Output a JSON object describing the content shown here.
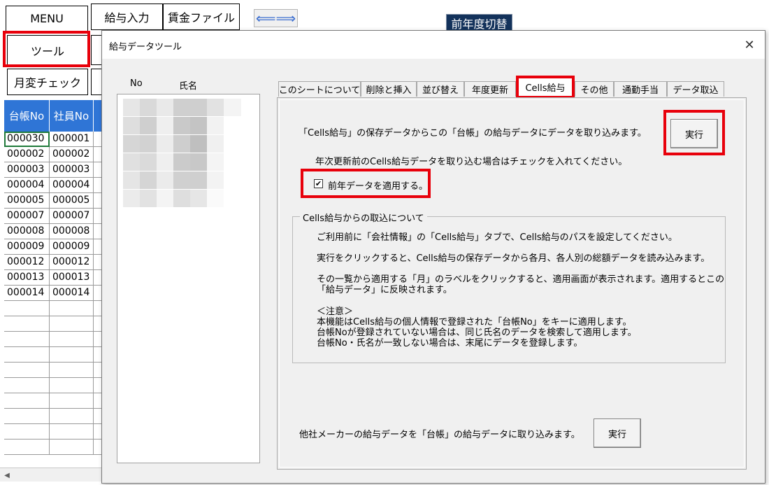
{
  "sheet": {
    "menu_label": "MENU",
    "payroll_input_label": "給与入力",
    "wage_file_label": "賃金ファイル",
    "swap_glyph": "⟸⟹",
    "prev_year_label": "前年度切替",
    "tool_label": "ツール",
    "monthly_check_label": "月変チェック",
    "col_ledger_no": "台帳No",
    "col_employee_no": "社員No",
    "rows": [
      [
        "000030",
        "000001"
      ],
      [
        "000002",
        "000002"
      ],
      [
        "000003",
        "000003"
      ],
      [
        "000004",
        "000004"
      ],
      [
        "000005",
        "000005"
      ],
      [
        "000007",
        "000007"
      ],
      [
        "000008",
        "000008"
      ],
      [
        "000009",
        "000009"
      ],
      [
        "000012",
        "000012"
      ],
      [
        "000013",
        "000013"
      ],
      [
        "000014",
        "000014"
      ]
    ]
  },
  "dialog": {
    "title": "給与データツール",
    "close_glyph": "✕",
    "list": {
      "col_no": "No",
      "col_name": "氏名"
    },
    "tabs": [
      "このシートについて",
      "削除と挿入",
      "並び替え",
      "年度更新",
      "Cells給与",
      "その他",
      "通勤手当",
      "データ取込"
    ],
    "active_tab": "Cells給与",
    "panel": {
      "import_desc": "「Cells給与」の保存データからこの「台帳」の給与データにデータを取り込みます。",
      "run_label": "実行",
      "check_hint": "年次更新前のCells給与データを取り込む場合はチェックを入れてください。",
      "checkbox_label": "前年データを適用する。",
      "checkbox_mark": "✔",
      "group_title": "Cells給与からの取込について",
      "group_lines": [
        "ご利用前に「会社情報」の「Cells給与」タブで、Cells給与のパスを設定してください。",
        "実行をクリックすると、Cells給与の保存データから各月、各人別の総額データを読み込みます。",
        "その一覧から適用する「月」のラベルをクリックすると、適用画面が表示されます。適用するとこの",
        "「給与データ」に反映されます。",
        "＜注意＞",
        "本機能はCells給与の個人情報で登録された「台帳No」をキーに適用します。",
        "台帳Noが登録されていない場合は、同じ氏名のデータを検索して適用します。",
        "台帳No・氏名が一致しない場合は、末尾にデータを登録します。"
      ],
      "other_desc": "他社メーカーの給与データを「台帳」の給与データに取り込みます。",
      "other_run_label": "実行"
    }
  },
  "colors": {
    "highlight_red": "#e8000b",
    "header_blue": "#2f75d6",
    "prev_year_navy": "#13325b"
  }
}
